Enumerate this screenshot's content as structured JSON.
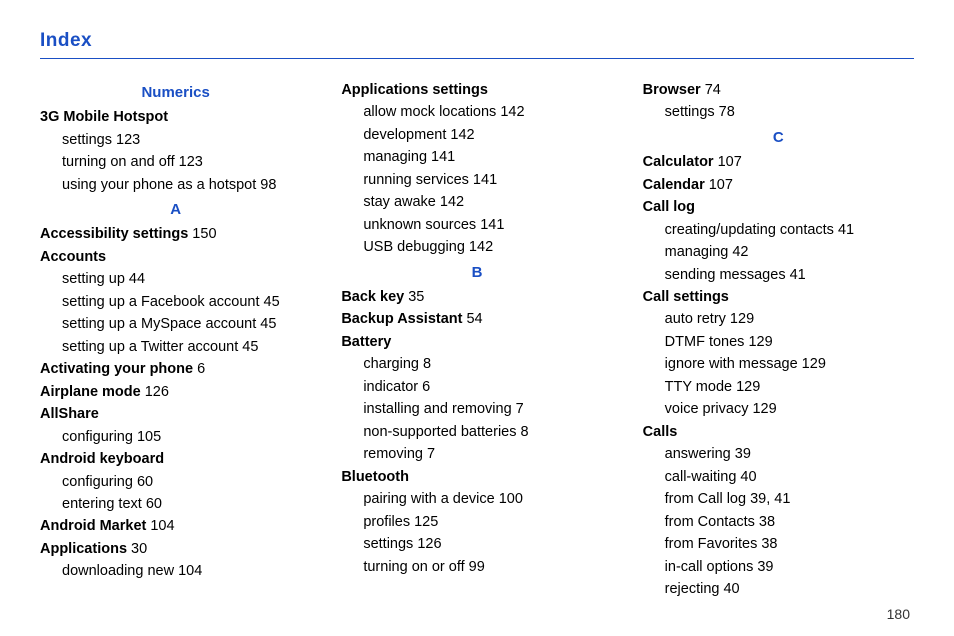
{
  "page_title": "Index",
  "page_number": "180",
  "columns": [
    {
      "sections": [
        {
          "heading": "Numerics",
          "entries": [
            {
              "term": "3G Mobile Hotspot",
              "page": "",
              "subs": [
                {
                  "text": "settings",
                  "page": "123"
                },
                {
                  "text": "turning on and off",
                  "page": "123"
                },
                {
                  "text": "using your phone as a hotspot",
                  "page": "98"
                }
              ]
            }
          ]
        },
        {
          "heading": "A",
          "entries": [
            {
              "term": "Accessibility settings",
              "page": "150",
              "subs": []
            },
            {
              "term": "Accounts",
              "page": "",
              "subs": [
                {
                  "text": "setting up",
                  "page": "44"
                },
                {
                  "text": "setting up a Facebook account",
                  "page": "45"
                },
                {
                  "text": "setting up a MySpace account",
                  "page": "45"
                },
                {
                  "text": "setting up a Twitter account",
                  "page": "45"
                }
              ]
            },
            {
              "term": "Activating your phone",
              "page": "6",
              "subs": []
            },
            {
              "term": "Airplane mode",
              "page": "126",
              "subs": []
            },
            {
              "term": "AllShare",
              "page": "",
              "subs": [
                {
                  "text": "configuring",
                  "page": "105"
                }
              ]
            },
            {
              "term": "Android keyboard",
              "page": "",
              "subs": [
                {
                  "text": "configuring",
                  "page": "60"
                },
                {
                  "text": "entering text",
                  "page": "60"
                }
              ]
            },
            {
              "term": "Android Market",
              "page": "104",
              "subs": []
            },
            {
              "term": "Applications",
              "page": "30",
              "subs": [
                {
                  "text": "downloading new",
                  "page": "104"
                }
              ]
            }
          ]
        }
      ]
    },
    {
      "sections": [
        {
          "heading": "",
          "entries": [
            {
              "term": "Applications settings",
              "page": "",
              "subs": [
                {
                  "text": "allow mock locations",
                  "page": "142"
                },
                {
                  "text": "development",
                  "page": "142"
                },
                {
                  "text": "managing",
                  "page": "141"
                },
                {
                  "text": "running services",
                  "page": "141"
                },
                {
                  "text": "stay awake",
                  "page": "142"
                },
                {
                  "text": "unknown sources",
                  "page": "141"
                },
                {
                  "text": "USB debugging",
                  "page": "142"
                }
              ]
            }
          ]
        },
        {
          "heading": "B",
          "entries": [
            {
              "term": "Back key",
              "page": "35",
              "subs": []
            },
            {
              "term": "Backup Assistant",
              "page": "54",
              "subs": []
            },
            {
              "term": "Battery",
              "page": "",
              "subs": [
                {
                  "text": "charging",
                  "page": "8"
                },
                {
                  "text": "indicator",
                  "page": "6"
                },
                {
                  "text": "installing and removing",
                  "page": "7"
                },
                {
                  "text": "non-supported batteries",
                  "page": "8"
                },
                {
                  "text": "removing",
                  "page": "7"
                }
              ]
            },
            {
              "term": "Bluetooth",
              "page": "",
              "subs": [
                {
                  "text": "pairing with a device",
                  "page": "100"
                },
                {
                  "text": "profiles",
                  "page": "125"
                },
                {
                  "text": "settings",
                  "page": "126"
                },
                {
                  "text": "turning on or off",
                  "page": "99"
                }
              ]
            }
          ]
        }
      ]
    },
    {
      "sections": [
        {
          "heading": "",
          "entries": [
            {
              "term": "Browser",
              "page": "74",
              "subs": [
                {
                  "text": "settings",
                  "page": "78"
                }
              ]
            }
          ]
        },
        {
          "heading": "C",
          "entries": [
            {
              "term": "Calculator",
              "page": "107",
              "subs": []
            },
            {
              "term": "Calendar",
              "page": "107",
              "subs": []
            },
            {
              "term": "Call log",
              "page": "",
              "subs": [
                {
                  "text": "creating/updating contacts",
                  "page": "41"
                },
                {
                  "text": "managing",
                  "page": "42"
                },
                {
                  "text": "sending messages",
                  "page": "41"
                }
              ]
            },
            {
              "term": "Call settings",
              "page": "",
              "subs": [
                {
                  "text": "auto retry",
                  "page": "129"
                },
                {
                  "text": "DTMF tones",
                  "page": "129"
                },
                {
                  "text": "ignore with message",
                  "page": "129"
                },
                {
                  "text": "TTY mode",
                  "page": "129"
                },
                {
                  "text": "voice privacy",
                  "page": "129"
                }
              ]
            },
            {
              "term": "Calls",
              "page": "",
              "subs": [
                {
                  "text": "answering",
                  "page": "39"
                },
                {
                  "text": "call-waiting",
                  "page": "40"
                },
                {
                  "text": "from Call log",
                  "page": "39, 41"
                },
                {
                  "text": "from Contacts",
                  "page": "38"
                },
                {
                  "text": "from Favorites",
                  "page": "38"
                },
                {
                  "text": "in-call options",
                  "page": "39"
                },
                {
                  "text": "rejecting",
                  "page": "40"
                }
              ]
            }
          ]
        }
      ]
    }
  ]
}
